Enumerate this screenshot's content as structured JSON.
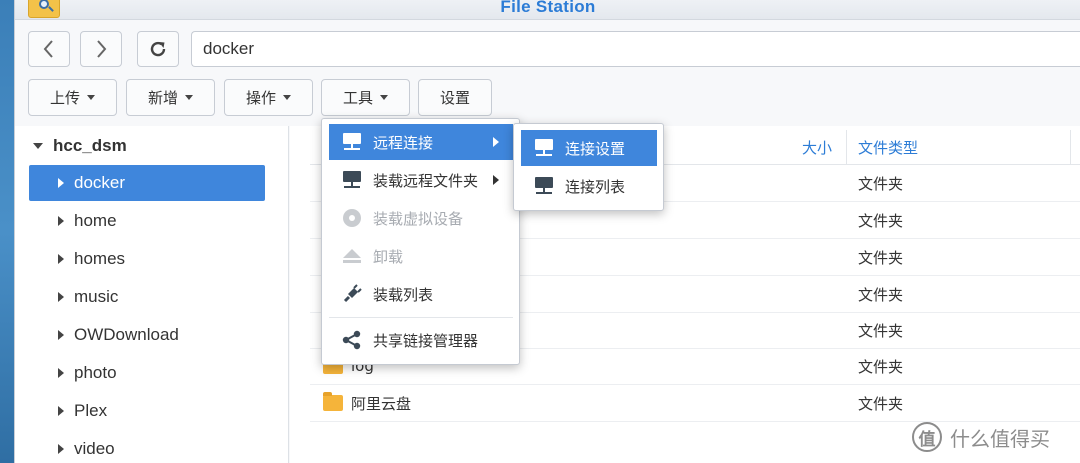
{
  "window": {
    "title": "File Station"
  },
  "address": {
    "path": "docker"
  },
  "toolbar": {
    "upload_label": "上传",
    "new_label": "新增",
    "action_label": "操作",
    "tools_label": "工具",
    "settings_label": "设置"
  },
  "sidebar": {
    "root": "hcc_dsm",
    "items": [
      {
        "label": "docker",
        "selected": true
      },
      {
        "label": "home"
      },
      {
        "label": "homes"
      },
      {
        "label": "music"
      },
      {
        "label": "OWDownload"
      },
      {
        "label": "photo"
      },
      {
        "label": "Plex"
      },
      {
        "label": "video"
      }
    ]
  },
  "table": {
    "headers": {
      "size": "大小",
      "type": "文件类型"
    },
    "rows": [
      {
        "name": "",
        "type": "文件夹"
      },
      {
        "name": "",
        "type": "文件夹"
      },
      {
        "name": "",
        "type": "文件夹"
      },
      {
        "name": "",
        "type": "文件夹"
      },
      {
        "name": "",
        "type": "文件夹"
      },
      {
        "name": "log",
        "type": "文件夹"
      },
      {
        "name": "阿里云盘",
        "type": "文件夹"
      }
    ]
  },
  "tools_menu": {
    "items": [
      {
        "label": "远程连接",
        "icon": "remote-connection-icon",
        "has_submenu": true,
        "active": true
      },
      {
        "label": "装载远程文件夹",
        "icon": "mount-remote-folder-icon",
        "has_submenu": true
      },
      {
        "label": "装载虚拟设备",
        "icon": "disc-icon",
        "disabled": true
      },
      {
        "label": "卸载",
        "icon": "eject-icon",
        "disabled": true
      },
      {
        "label": "装载列表",
        "icon": "plug-icon"
      },
      {
        "label": "共享链接管理器",
        "icon": "share-icon"
      }
    ]
  },
  "remote_submenu": {
    "items": [
      {
        "label": "连接设置",
        "icon": "network-icon",
        "active": true
      },
      {
        "label": "连接列表",
        "icon": "network-icon"
      }
    ]
  },
  "watermark": {
    "text": "什么值得买",
    "mark": "值"
  },
  "colors": {
    "accent": "#3f86dc",
    "title": "#2c7cd6",
    "folder": "#f5b43a"
  }
}
